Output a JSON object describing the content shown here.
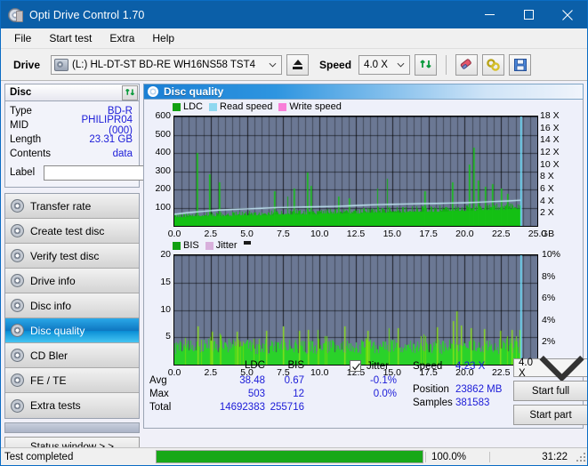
{
  "window": {
    "title": "Opti Drive Control 1.70",
    "icon": "disc-icon",
    "minimize": "minimize",
    "maximize": "maximize",
    "close": "close"
  },
  "menu": {
    "items": [
      "File",
      "Start test",
      "Extra",
      "Help"
    ]
  },
  "toolbar": {
    "drive_label": "Drive",
    "drive_value": "(L:)  HL-DT-ST BD-RE  WH16NS58 TST4",
    "eject": "eject-icon",
    "speed_label": "Speed",
    "speed_value": "4.0 X",
    "refresh": "refresh-icon",
    "erase": "eraser-icon",
    "tools": "tools-icon",
    "save": "save-icon"
  },
  "disc_panel": {
    "title": "Disc",
    "refresh_icon": "refresh-icon",
    "rows": [
      {
        "key": "Type",
        "value": "BD-R"
      },
      {
        "key": "MID",
        "value": "PHILIPR04 (000)"
      },
      {
        "key": "Length",
        "value": "23.31 GB"
      },
      {
        "key": "Contents",
        "value": "data"
      }
    ],
    "label_key": "Label",
    "label_value": "",
    "label_placeholder": "",
    "label_button_icon": "cd-icon"
  },
  "nav": {
    "items": [
      {
        "label": "Transfer rate",
        "active": false
      },
      {
        "label": "Create test disc",
        "active": false
      },
      {
        "label": "Verify test disc",
        "active": false
      },
      {
        "label": "Drive info",
        "active": false
      },
      {
        "label": "Disc info",
        "active": false
      },
      {
        "label": "Disc quality",
        "active": true
      },
      {
        "label": "CD Bler",
        "active": false
      },
      {
        "label": "FE / TE",
        "active": false
      },
      {
        "label": "Extra tests",
        "active": false
      }
    ],
    "status_window": "Status window > >"
  },
  "panel": {
    "title": "Disc quality",
    "icon": "disc-quality-icon"
  },
  "chart_data": [
    {
      "type": "line",
      "name": "top-chart",
      "title": "",
      "legend": [
        {
          "label": "LDC",
          "color": "#12a012"
        },
        {
          "label": "Read speed",
          "color": "#8fd8f0"
        },
        {
          "label": "Write speed",
          "color": "#f87fd8"
        }
      ],
      "legend_position": "top-left",
      "xlabel": "GB",
      "x": [
        0.0,
        2.5,
        5.0,
        7.5,
        10.0,
        12.5,
        15.0,
        17.5,
        20.0,
        22.5,
        25.0
      ],
      "xlim": [
        0,
        25.0
      ],
      "ylabel_left": "LDC",
      "ylim_left": [
        0,
        600
      ],
      "yticks_left": [
        100,
        200,
        300,
        400,
        500,
        600
      ],
      "ylabel_right": "X",
      "ylim_right": [
        0,
        18
      ],
      "yticks_right": [
        "2 X",
        "4 X",
        "6 X",
        "8 X",
        "10 X",
        "12 X",
        "14 X",
        "16 X",
        "18 X"
      ],
      "grid": true,
      "data_end_gb": 23.862,
      "cursor_gb": 23.862,
      "series": [
        {
          "name": "LDC",
          "color": "#12a012",
          "baseline": [
            62,
            64,
            66,
            68,
            70,
            72,
            74,
            76,
            78,
            80,
            82,
            84,
            86,
            88,
            90,
            92,
            94,
            96,
            98,
            100,
            103,
            106,
            109,
            112
          ],
          "avg": 38.48,
          "max": 503
        },
        {
          "name": "Read speed",
          "color": "#b9e6f7",
          "x_gb": [
            0.0,
            1.0,
            2.0,
            3.0,
            4.0,
            5.0,
            6.0,
            7.0,
            8.0,
            9.0,
            10.0,
            11.0,
            12.0,
            13.0,
            14.0,
            15.0,
            16.0,
            17.0,
            18.0,
            19.0,
            20.0,
            21.0,
            22.0,
            23.0,
            23.86
          ],
          "values_x": [
            1.9,
            2.2,
            2.4,
            2.6,
            2.7,
            2.8,
            2.9,
            3.0,
            3.05,
            3.1,
            3.15,
            3.2,
            3.3,
            3.4,
            3.5,
            3.55,
            3.6,
            3.65,
            3.7,
            3.75,
            3.8,
            3.9,
            4.0,
            4.1,
            4.23
          ]
        }
      ]
    },
    {
      "type": "bar",
      "name": "bottom-chart",
      "title": "",
      "legend": [
        {
          "label": "BIS",
          "color": "#12a012"
        },
        {
          "label": "Jitter",
          "color": "#d8b0dc"
        }
      ],
      "legend_position": "top-left",
      "xlabel": "GB",
      "x": [
        0.0,
        2.5,
        5.0,
        7.5,
        10.0,
        12.5,
        15.0,
        17.5,
        20.0,
        22.5,
        25.0
      ],
      "xlim": [
        0,
        25.0
      ],
      "ylabel_left": "BIS",
      "ylim_left": [
        0,
        20
      ],
      "yticks_left": [
        5,
        10,
        15,
        20
      ],
      "ylabel_right": "%",
      "ylim_right": [
        0,
        10
      ],
      "yticks_right": [
        "2%",
        "4%",
        "6%",
        "8%",
        "10%"
      ],
      "grid": true,
      "data_end_gb": 23.862,
      "cursor_gb": 23.862,
      "series": [
        {
          "name": "BIS",
          "color": "#2bd42b",
          "avg": 0.67,
          "max": 12,
          "typical": 3.6
        }
      ]
    }
  ],
  "stats": {
    "col_headers": [
      "LDC",
      "BIS"
    ],
    "rows": [
      {
        "label": "Avg",
        "ldc": "38.48",
        "bis": "0.67",
        "jitter": "-0.1%"
      },
      {
        "label": "Max",
        "ldc": "503",
        "bis": "12",
        "jitter": "0.0%"
      },
      {
        "label": "Total",
        "ldc": "14692383",
        "bis": "255716",
        "jitter": ""
      }
    ],
    "jitter_label": "Jitter",
    "jitter_checked": true,
    "speed_label": "Speed",
    "speed_value": "4.23 X",
    "position_label": "Position",
    "position_value": "23862 MB",
    "samples_label": "Samples",
    "samples_value": "381583",
    "speed_select": "4.0 X",
    "start_full": "Start full",
    "start_part": "Start part"
  },
  "statusbar": {
    "text": "Test completed",
    "percent": "100.0%",
    "progress": 100,
    "time": "31:22"
  },
  "colors": {
    "titlebar": "#0b5fa8",
    "accent": "#1b1bd8",
    "plot_bg": "#6b7894",
    "green": "#12a012",
    "cursor": "#6fe3ff",
    "progress": "#18a818"
  }
}
